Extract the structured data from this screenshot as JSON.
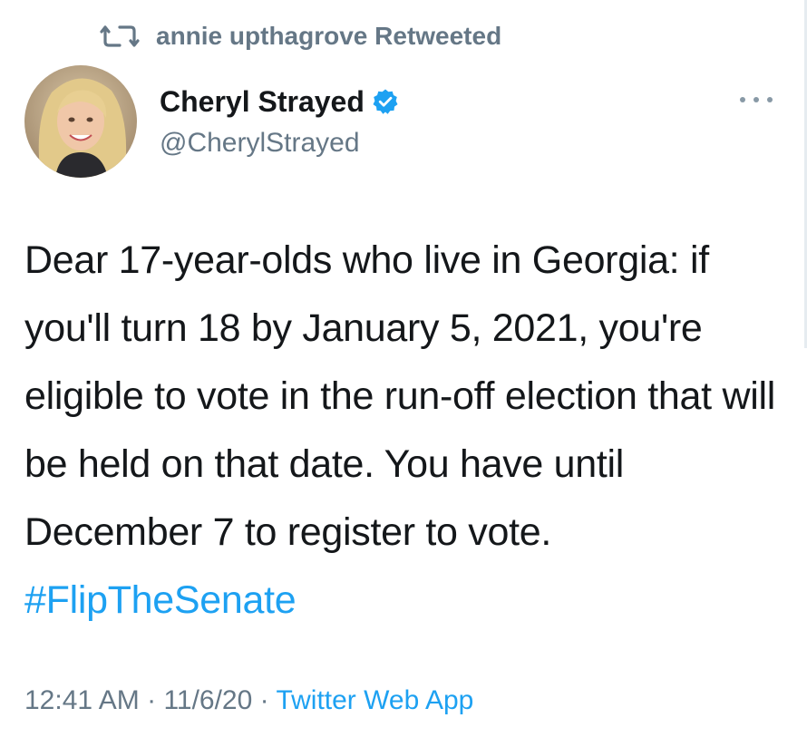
{
  "retweet": {
    "icon": "retweet-icon",
    "text": "annie upthagrove Retweeted"
  },
  "author": {
    "display_name": "Cheryl Strayed",
    "handle": "@CherylStrayed",
    "verified_icon": "verified-badge-icon"
  },
  "more_icon": "more-options-icon",
  "tweet": {
    "text": "Dear 17-year-olds who live in Georgia: if you'll turn 18 by January 5, 2021, you're eligible to vote in the run-off election that will be held on that date. You have until December 7 to register to vote. ",
    "hashtag": "#FlipTheSenate"
  },
  "meta": {
    "time": "12:41 AM",
    "sep1": " · ",
    "date": "11/6/20",
    "sep2": " · ",
    "source": "Twitter Web App"
  },
  "colors": {
    "link": "#1da1f2",
    "secondary": "#657786",
    "text": "#14171a"
  }
}
